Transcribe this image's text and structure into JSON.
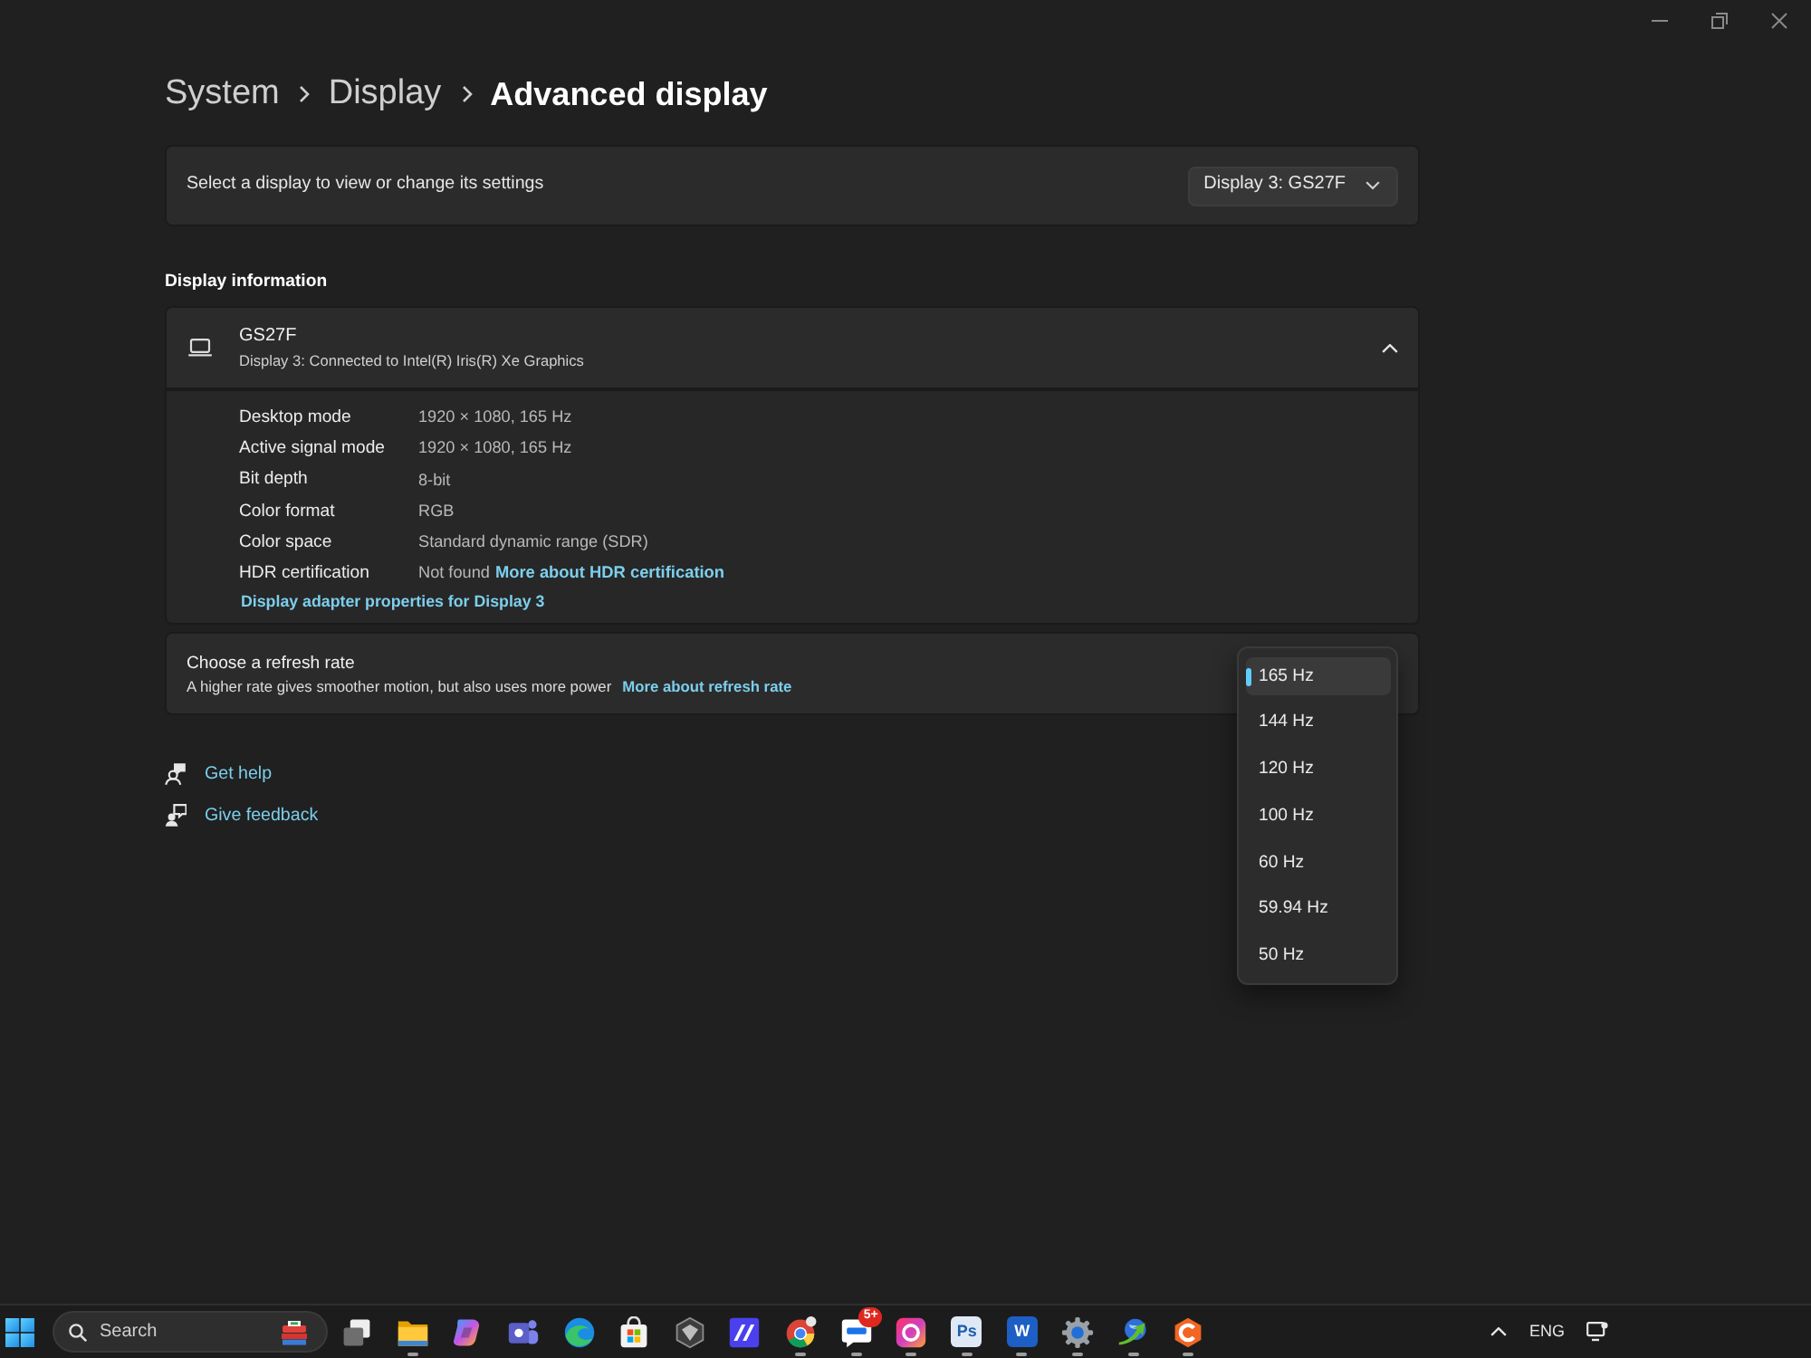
{
  "breadcrumb": [
    {
      "label": "System",
      "current": false
    },
    {
      "label": "Display",
      "current": false
    },
    {
      "label": "Advanced display",
      "current": true
    }
  ],
  "display_selector": {
    "label": "Select a display to view or change its settings",
    "value": "Display 3: GS27F"
  },
  "display_information": {
    "heading": "Display information",
    "device": {
      "name": "GS27F",
      "description": "Display 3: Connected to Intel(R) Iris(R) Xe Graphics",
      "expanded": true
    },
    "properties": [
      {
        "label": "Desktop mode",
        "value": "1920 × 1080, 165 Hz"
      },
      {
        "label": "Active signal mode",
        "value": "1920 × 1080, 165 Hz"
      },
      {
        "label": "Bit depth",
        "value": "8-bit"
      },
      {
        "label": "Color format",
        "value": "RGB"
      },
      {
        "label": "Color space",
        "value": "Standard dynamic range (SDR)"
      },
      {
        "label": "HDR certification",
        "value": "Not found",
        "link": "More about HDR certification"
      }
    ],
    "adapter_link": "Display adapter properties for Display 3"
  },
  "refresh_rate": {
    "title": "Choose a refresh rate",
    "description": "A higher rate gives smoother motion, but also uses more power",
    "link": "More about refresh rate",
    "options": [
      {
        "label": "165 Hz",
        "selected": true
      },
      {
        "label": "144 Hz",
        "selected": false
      },
      {
        "label": "120 Hz",
        "selected": false
      },
      {
        "label": "100 Hz",
        "selected": false
      },
      {
        "label": "60 Hz",
        "selected": false
      },
      {
        "label": "59.94 Hz",
        "selected": false
      },
      {
        "label": "50 Hz",
        "selected": false
      }
    ]
  },
  "help_links": [
    {
      "kind": "help",
      "label": "Get help"
    },
    {
      "kind": "feedback",
      "label": "Give feedback"
    }
  ],
  "taskbar": {
    "search": {
      "placeholder": "Search"
    },
    "apps": [
      {
        "kind": "taskview",
        "running": false
      },
      {
        "kind": "folder",
        "running": true
      },
      {
        "kind": "swirl",
        "running": false
      },
      {
        "kind": "people",
        "running": false
      },
      {
        "kind": "wave",
        "running": false
      },
      {
        "kind": "bag",
        "running": false
      },
      {
        "kind": "hexagon",
        "running": false
      },
      {
        "kind": "stripes",
        "running": false
      },
      {
        "kind": "tricolor",
        "running": true
      },
      {
        "kind": "chat",
        "running": true,
        "badge": "5+"
      },
      {
        "kind": "gradient",
        "running": true
      },
      {
        "kind": "lighttile",
        "glyph": "Ps",
        "running": true
      },
      {
        "kind": "bluetile",
        "glyph": "W",
        "running": true
      },
      {
        "kind": "gear",
        "running": true
      },
      {
        "kind": "globe",
        "running": true
      },
      {
        "kind": "ring",
        "running": true
      }
    ],
    "tray": {
      "language": "ENG"
    }
  }
}
